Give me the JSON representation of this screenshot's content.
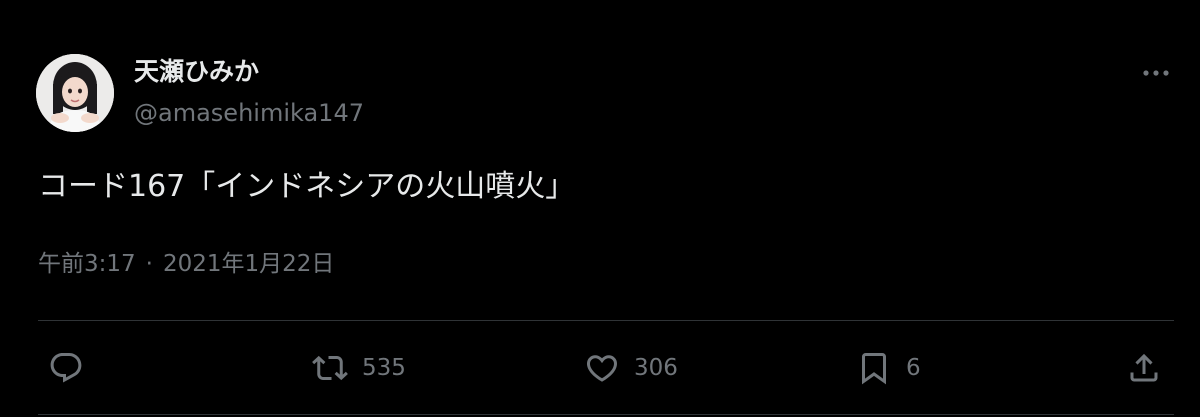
{
  "author": {
    "display_name": "天瀬ひみか",
    "handle": "@amasehimika147",
    "avatar_icon": "profile-photo"
  },
  "tweet": {
    "text": "コード167「インドネシアの火山噴火」",
    "time": "午前3:17",
    "separator": "·",
    "date": "2021年1月22日"
  },
  "actions": {
    "reply": {
      "icon": "reply-icon",
      "count": ""
    },
    "retweet": {
      "icon": "retweet-icon",
      "count": "535"
    },
    "like": {
      "icon": "heart-icon",
      "count": "306"
    },
    "bookmark": {
      "icon": "bookmark-icon",
      "count": "6"
    },
    "share": {
      "icon": "share-icon",
      "count": ""
    }
  },
  "colors": {
    "background": "#000000",
    "text_primary": "#e7e9ea",
    "text_secondary": "#71767b",
    "divider": "#2f3336"
  }
}
